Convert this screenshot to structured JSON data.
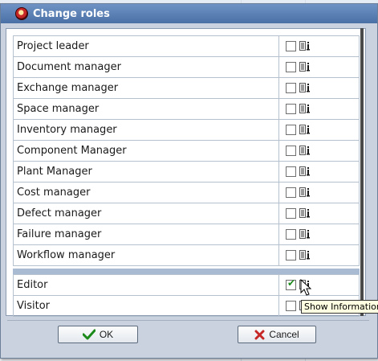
{
  "dialog": {
    "title": "Change roles",
    "icon": "app-logo-icon"
  },
  "roles_primary": [
    {
      "label": "Project leader",
      "checked": false
    },
    {
      "label": "Document manager",
      "checked": false
    },
    {
      "label": "Exchange manager",
      "checked": false
    },
    {
      "label": "Space manager",
      "checked": false
    },
    {
      "label": "Inventory manager",
      "checked": false
    },
    {
      "label": "Component Manager",
      "checked": false
    },
    {
      "label": "Plant Manager",
      "checked": false
    },
    {
      "label": "Cost manager",
      "checked": false
    },
    {
      "label": "Defect manager",
      "checked": false
    },
    {
      "label": "Failure manager",
      "checked": false
    },
    {
      "label": "Workflow manager",
      "checked": false
    }
  ],
  "roles_secondary": [
    {
      "label": "Editor",
      "checked": true
    },
    {
      "label": "Visitor",
      "checked": false
    }
  ],
  "tooltip": {
    "text": "Show Information"
  },
  "buttons": {
    "ok_label": "OK",
    "cancel_label": "Cancel"
  },
  "colors": {
    "titlebar": "#4a70a6",
    "separator": "#a9bbd3",
    "ok_check": "#1b8a1b",
    "cancel_x": "#c62828"
  }
}
